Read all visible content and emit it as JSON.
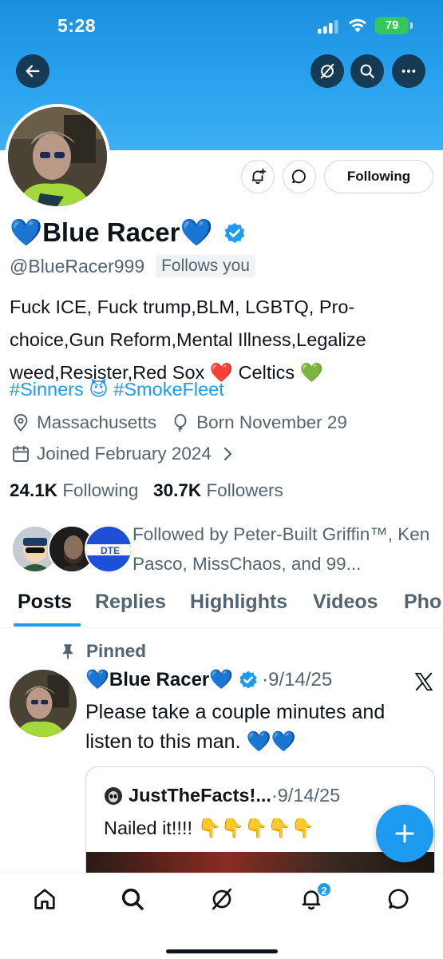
{
  "status_bar": {
    "time": "5:28",
    "battery": "79"
  },
  "header": {
    "back_icon": "arrow-left-icon",
    "grok_icon": "grok-icon",
    "search_icon": "search-icon",
    "more_icon": "more-icon"
  },
  "profile": {
    "display_name": "💙Blue Racer💙",
    "handle": "@BlueRacer999",
    "follows_you": "Follows you",
    "follow_button": "Following",
    "bio": "Fuck ICE, Fuck trump,BLM, LGBTQ, Pro-choice,Gun Reform,Mental Illness,Legalize weed,Resister,Red Sox ❤️ Celtics 💚",
    "hashtags": "#Sinners 😈 #SmokeFleet",
    "location": "Massachusetts",
    "birthday": "Born November 29",
    "joined": "Joined February 2024",
    "following_count": "24.1K",
    "following_label": "Following",
    "followers_count": "30.7K",
    "followers_label": "Followers",
    "followed_by": "Followed by Peter-Built Griffin™, Ken Pasco, MissChaos, and 99...",
    "followed_by_third_avatar_text": "DTE"
  },
  "tabs": [
    "Posts",
    "Replies",
    "Highlights",
    "Videos",
    "Pho"
  ],
  "pinned_post": {
    "pinned_label": "Pinned",
    "author": "💙Blue Racer💙",
    "date": "·9/14/25",
    "text": "Please take a couple minutes and listen to this man. 💙💙",
    "quote": {
      "author": "JustTheFacts!...",
      "date": "·9/14/25",
      "text": "Nailed it!!!! 👇👇👇👇👇"
    }
  },
  "bottom_nav": {
    "items": [
      "home-icon",
      "search-icon",
      "grok-icon",
      "notifications-icon",
      "messages-icon"
    ],
    "notification_badge": "2"
  },
  "colors": {
    "accent": "#1d9bf0",
    "banner": "#2aa2ee",
    "text": "#0f1419",
    "secondary": "#536471"
  }
}
